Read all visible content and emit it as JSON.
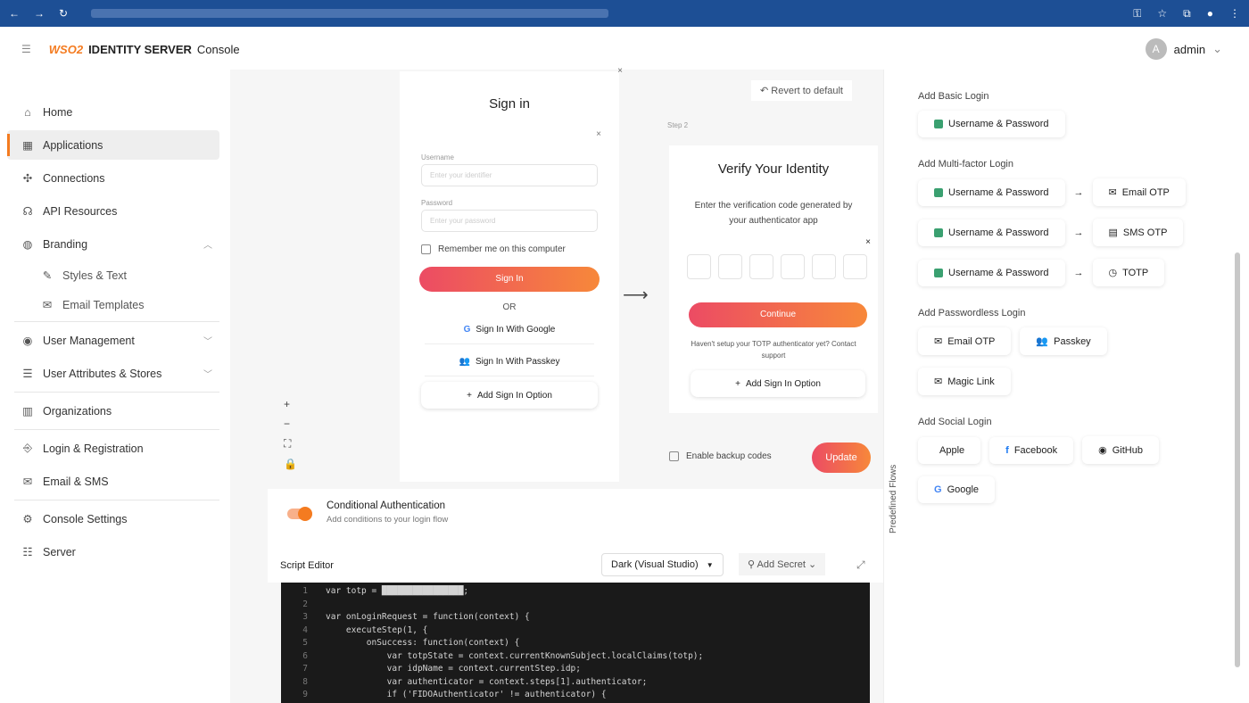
{
  "app": {
    "brand": "WSO2",
    "title": "IDENTITY SERVER",
    "subtitle": "Console",
    "user": "admin",
    "avatar": "A"
  },
  "sidebar": {
    "items": [
      {
        "label": "Home",
        "icon": "home-icon"
      },
      {
        "label": "Applications",
        "icon": "grid-icon"
      },
      {
        "label": "Connections",
        "icon": "connections-icon"
      },
      {
        "label": "API Resources",
        "icon": "api-icon"
      },
      {
        "label": "Branding",
        "icon": "palette-icon"
      },
      {
        "label": "Styles & Text",
        "icon": "brush-icon"
      },
      {
        "label": "Email Templates",
        "icon": "mail-icon"
      },
      {
        "label": "User Management",
        "icon": "user-icon"
      },
      {
        "label": "User Attributes & Stores",
        "icon": "database-icon"
      },
      {
        "label": "Organizations",
        "icon": "building-icon"
      },
      {
        "label": "Login & Registration",
        "icon": "login-icon"
      },
      {
        "label": "Email & SMS",
        "icon": "mail-icon"
      },
      {
        "label": "Console Settings",
        "icon": "gear-icon"
      },
      {
        "label": "Server",
        "icon": "server-icon"
      }
    ]
  },
  "flow": {
    "revert": "Revert to default",
    "step2_label": "Step 2",
    "signin": {
      "title": "Sign in",
      "username_label": "Username",
      "username_placeholder": "Enter your identifier",
      "password_label": "Password",
      "password_placeholder": "Enter your password",
      "remember": "Remember me on this computer",
      "button": "Sign In",
      "or": "OR",
      "google": "Sign In With Google",
      "passkey": "Sign In With Passkey",
      "add": "Add Sign In Option"
    },
    "verify": {
      "title": "Verify Your Identity",
      "desc": "Enter the verification code generated by your authenticator app",
      "button": "Continue",
      "help": "Haven't setup your TOTP authenticator yet? Contact support",
      "add": "Add Sign In Option"
    },
    "backup": "Enable backup codes",
    "update": "Update"
  },
  "conditional": {
    "title": "Conditional Authentication",
    "desc": "Add conditions to your login flow",
    "enabled": true
  },
  "editor": {
    "label": "Script Editor",
    "theme": "Dark (Visual Studio)",
    "secret": "Add Secret",
    "lines": [
      "var totp = ████████████████;",
      "",
      "var onLoginRequest = function(context) {",
      "    executeStep(1, {",
      "        onSuccess: function(context) {",
      "            var totpState = context.currentKnownSubject.localClaims(totp);",
      "            var idpName = context.currentStep.idp;",
      "            var authenticator = context.steps[1].authenticator;",
      "            if ('FIDOAuthenticator' != authenticator) {"
    ]
  },
  "predefined": {
    "tab": "Predefined Flows",
    "basic_h": "Add Basic Login",
    "up": "Username & Password",
    "mfa_h": "Add Multi-factor Login",
    "mfa": [
      "Email OTP",
      "SMS OTP",
      "TOTP"
    ],
    "pwless_h": "Add Passwordless Login",
    "pwless": [
      "Email OTP",
      "Passkey",
      "Magic Link"
    ],
    "social_h": "Add Social Login",
    "social": [
      "Apple",
      "Facebook",
      "GitHub",
      "Google"
    ]
  }
}
